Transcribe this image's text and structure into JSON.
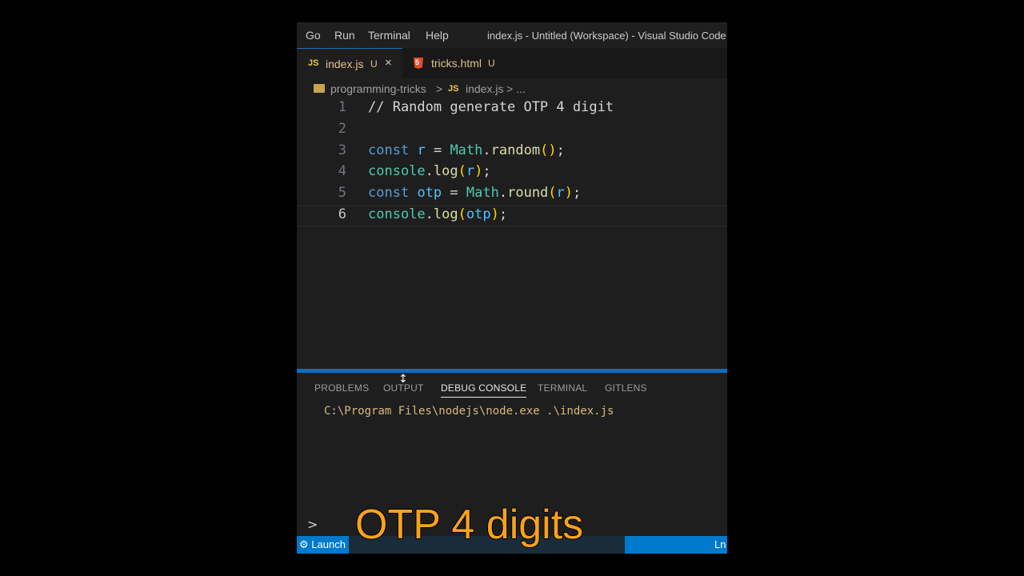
{
  "menubar": {
    "items": [
      "Go",
      "Run",
      "Terminal",
      "Help"
    ],
    "window_title": "index.js - Untitled (Workspace) - Visual Studio Code"
  },
  "tabs": [
    {
      "icon": "JS",
      "name": "index.js",
      "status": "U",
      "close": "×"
    },
    {
      "icon": "html5-icon",
      "name": "tricks.html",
      "status": "U"
    }
  ],
  "breadcrumb": {
    "folder": "programming-tricks",
    "sep": ">",
    "file_icon": "JS",
    "file": "index.js",
    "more": "> ..."
  },
  "editor": {
    "lines": [
      {
        "num": "1",
        "text": "// Random generate OTP 4 digit"
      },
      {
        "num": "2",
        "text": ""
      },
      {
        "num": "3",
        "text": "const r = Math.random();"
      },
      {
        "num": "4",
        "text": "console.log(r);"
      },
      {
        "num": "5",
        "text": "const otp = Math.round(r);"
      },
      {
        "num": "6",
        "text": "console.log(otp);"
      }
    ],
    "current_line": 6
  },
  "panel": {
    "tabs": [
      "PROBLEMS",
      "OUTPUT",
      "DEBUG CONSOLE",
      "TERMINAL",
      "GITLENS"
    ],
    "active_tab": "DEBUG CONSOLE",
    "console_output": "C:\\Program Files\\nodejs\\node.exe .\\index.js",
    "prompt": ">"
  },
  "statusbar": {
    "launch": "Launch",
    "position": "Ln"
  },
  "caption": "OTP 4 digits",
  "colors": {
    "accent": "#007acc",
    "caption": "#f7a21d",
    "comment": "#6a9955",
    "keyword": "#569cd6"
  }
}
